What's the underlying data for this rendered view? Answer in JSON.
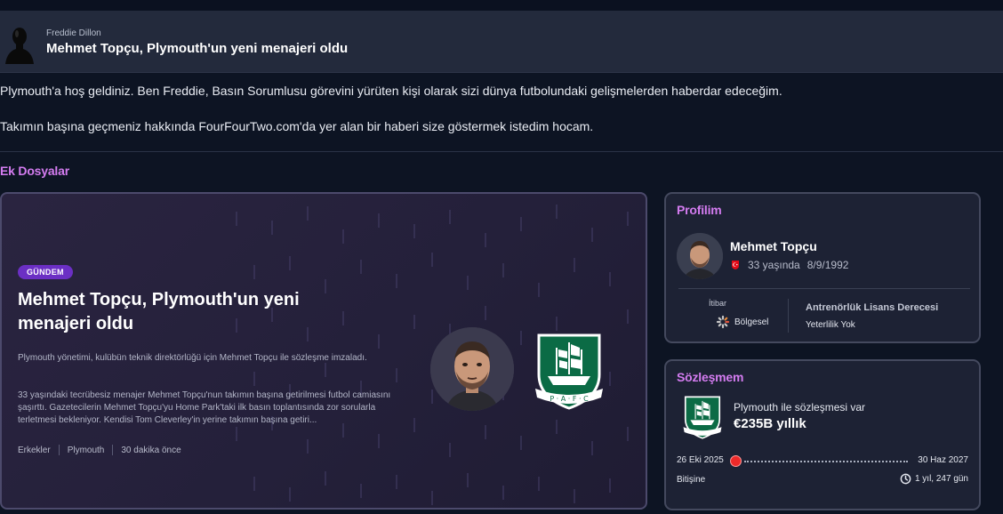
{
  "message": {
    "sender": "Freddie Dillon",
    "title": "Mehmet Topçu, Plymouth'un yeni menajeri oldu",
    "paragraph1": "Plymouth'a hoş geldiniz. Ben Freddie,  Basın Sorumlusu görevini yürüten kişi olarak sizi dünya futbolundaki gelişmelerden haberdar edeceğim.",
    "paragraph2": "Takımın başına geçmeniz hakkında FourFourTwo.com'da yer alan bir haberi size göstermek istedim hocam."
  },
  "attachments": {
    "section_title": "Ek Dosyalar",
    "news": {
      "tag": "GÜNDEM",
      "headline": "Mehmet Topçu, Plymouth'un yeni menajeri oldu",
      "summary": "Plymouth yönetimi, kulübün teknik direktörlüğü için Mehmet Topçu ile sözleşme imzaladı.",
      "detail": "33 yaşındaki tecrübesiz menajer Mehmet Topçu'nun takımın başına getirilmesi futbol camiasını şaşırttı. Gazetecilerin Mehmet Topçu'yu Home Park'taki ilk basın toplantısında zor sorularla terletmesi bekleniyor. Kendisi Tom Cleverley'in yerine takımın başına getiri...",
      "meta": [
        "Erkekler",
        "Plymouth",
        "30 dakika önce"
      ]
    }
  },
  "profile": {
    "title": "Profilim",
    "name": "Mehmet Topçu",
    "age": "33 yaşında",
    "dob": "8/9/1992",
    "reputation_label": "İtibar",
    "reputation_value": "Bölgesel",
    "license_label": "Antrenörlük Lisans Derecesi",
    "license_value": "Yeterlilik Yok"
  },
  "contract": {
    "title": "Sözleşmem",
    "club_line": "Plymouth ile sözleşmesi var",
    "wage": "€235B yıllık",
    "start_date": "26 Eki 2025",
    "end_date": "30 Haz 2027",
    "end_label": "Bitişine",
    "remaining": "1 yıl, 247 gün"
  },
  "colors": {
    "accent": "#d47cf0",
    "tag": "#6b2fc4",
    "timeline_dot": "#ee2a2a",
    "club_green": "#0b6b45"
  },
  "icons": [
    "person-silhouette-icon",
    "turkey-flag-icon",
    "reputation-dial-icon",
    "timer-icon",
    "plymouth-crest"
  ]
}
